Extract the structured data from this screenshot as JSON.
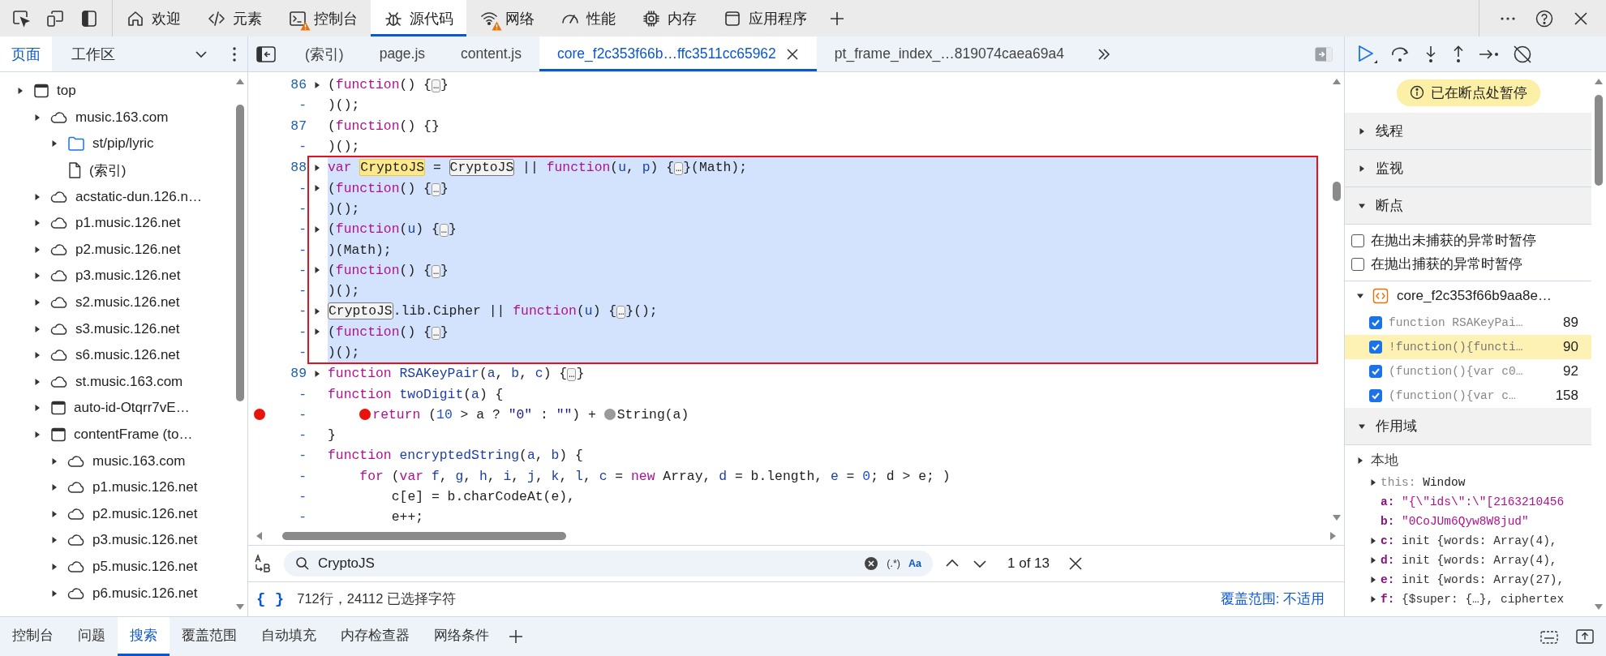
{
  "tabs": [
    {
      "label": "欢迎",
      "selected": false,
      "warning": false
    },
    {
      "label": "元素",
      "selected": false,
      "warning": false
    },
    {
      "label": "控制台",
      "selected": false,
      "warning": true
    },
    {
      "label": "源代码",
      "selected": true,
      "warning": false
    },
    {
      "label": "网络",
      "selected": false,
      "warning": true
    },
    {
      "label": "性能",
      "selected": false,
      "warning": false
    },
    {
      "label": "内存",
      "selected": false,
      "warning": false
    },
    {
      "label": "应用程序",
      "selected": false,
      "warning": false
    }
  ],
  "sidebar": {
    "tabs": [
      {
        "label": "页面",
        "selected": true
      },
      {
        "label": "工作区",
        "selected": false
      }
    ],
    "tree": [
      {
        "label": "top",
        "kind": "frame",
        "expandable": true,
        "children": [
          {
            "label": "music.163.com",
            "kind": "origin",
            "expandable": true,
            "children": [
              {
                "label": "st/pip/lyric",
                "kind": "folder",
                "expandable": true
              },
              {
                "label": "(索引)",
                "kind": "file",
                "expandable": false
              }
            ]
          },
          {
            "label": "acstatic-dun.126.n…",
            "kind": "origin",
            "expandable": true
          },
          {
            "label": "p1.music.126.net",
            "kind": "origin",
            "expandable": true
          },
          {
            "label": "p2.music.126.net",
            "kind": "origin",
            "expandable": true
          },
          {
            "label": "p3.music.126.net",
            "kind": "origin",
            "expandable": true
          },
          {
            "label": "s2.music.126.net",
            "kind": "origin",
            "expandable": true
          },
          {
            "label": "s3.music.126.net",
            "kind": "origin",
            "expandable": true
          },
          {
            "label": "s6.music.126.net",
            "kind": "origin",
            "expandable": true
          },
          {
            "label": "st.music.163.com",
            "kind": "origin",
            "expandable": true
          },
          {
            "label": "auto-id-Otqrr7vE…",
            "kind": "frame",
            "expandable": true
          },
          {
            "label": "contentFrame (to…",
            "kind": "frame",
            "expandable": true,
            "children": [
              {
                "label": "music.163.com",
                "kind": "origin",
                "expandable": true
              },
              {
                "label": "p1.music.126.net",
                "kind": "origin",
                "expandable": true
              },
              {
                "label": "p2.music.126.net",
                "kind": "origin",
                "expandable": true
              },
              {
                "label": "p3.music.126.net",
                "kind": "origin",
                "expandable": true
              },
              {
                "label": "p5.music.126.net",
                "kind": "origin",
                "expandable": true
              },
              {
                "label": "p6.music.126.net",
                "kind": "origin",
                "expandable": true
              }
            ]
          }
        ]
      }
    ]
  },
  "file_tabs": [
    {
      "label": "(索引)",
      "selected": false,
      "close_button": false
    },
    {
      "label": "page.js",
      "selected": false,
      "close_button": false
    },
    {
      "label": "content.js",
      "selected": false,
      "close_button": false
    },
    {
      "label": "core_f2c353f66b…ffc3511cc65962",
      "selected": true,
      "close_button": true
    },
    {
      "label": "pt_frame_index_…819074caea69a4",
      "selected": false,
      "close_button": false
    }
  ],
  "code": {
    "lines": [
      {
        "number": "86",
        "foldable": true,
        "selected": false,
        "breakpoint": false,
        "segments": [
          {
            "text": "("
          },
          {
            "text": "function",
            "kind": "keyword"
          },
          {
            "text": "() {"
          },
          {
            "text": "…",
            "kind": "fold"
          },
          {
            "text": "}"
          }
        ]
      },
      {
        "number": "-",
        "foldable": false,
        "selected": false,
        "breakpoint": false,
        "segments": [
          {
            "text": ")();"
          }
        ]
      },
      {
        "number": "87",
        "foldable": false,
        "selected": false,
        "breakpoint": false,
        "segments": [
          {
            "text": "("
          },
          {
            "text": "function",
            "kind": "keyword"
          },
          {
            "text": "() {}"
          }
        ]
      },
      {
        "number": "-",
        "foldable": false,
        "selected": false,
        "breakpoint": false,
        "segments": [
          {
            "text": ")();"
          }
        ]
      },
      {
        "number": "88",
        "foldable": true,
        "selected": true,
        "breakpoint": false,
        "segments": [
          {
            "text": "var ",
            "kind": "keyword"
          },
          {
            "text": "CryptoJS",
            "kind": "current_match"
          },
          {
            "text": " = "
          },
          {
            "text": "CryptoJS",
            "kind": "match"
          },
          {
            "text": " || "
          },
          {
            "text": "function",
            "kind": "keyword"
          },
          {
            "text": "("
          },
          {
            "text": "u",
            "kind": "ident"
          },
          {
            "text": ", "
          },
          {
            "text": "p",
            "kind": "ident"
          },
          {
            "text": ") {"
          },
          {
            "text": "…",
            "kind": "fold"
          },
          {
            "text": "}(Math);"
          }
        ]
      },
      {
        "number": "-",
        "foldable": true,
        "selected": true,
        "breakpoint": false,
        "segments": [
          {
            "text": "("
          },
          {
            "text": "function",
            "kind": "keyword"
          },
          {
            "text": "() {"
          },
          {
            "text": "…",
            "kind": "fold"
          },
          {
            "text": "}"
          }
        ]
      },
      {
        "number": "-",
        "foldable": false,
        "selected": true,
        "breakpoint": false,
        "segments": [
          {
            "text": ")();"
          }
        ]
      },
      {
        "number": "-",
        "foldable": true,
        "selected": true,
        "breakpoint": false,
        "segments": [
          {
            "text": "("
          },
          {
            "text": "function",
            "kind": "keyword"
          },
          {
            "text": "("
          },
          {
            "text": "u",
            "kind": "ident"
          },
          {
            "text": ") {"
          },
          {
            "text": "…",
            "kind": "fold"
          },
          {
            "text": "}"
          }
        ]
      },
      {
        "number": "-",
        "foldable": false,
        "selected": true,
        "breakpoint": false,
        "segments": [
          {
            "text": ")(Math);"
          }
        ]
      },
      {
        "number": "-",
        "foldable": true,
        "selected": true,
        "breakpoint": false,
        "segments": [
          {
            "text": "("
          },
          {
            "text": "function",
            "kind": "keyword"
          },
          {
            "text": "() {"
          },
          {
            "text": "…",
            "kind": "fold"
          },
          {
            "text": "}"
          }
        ]
      },
      {
        "number": "-",
        "foldable": false,
        "selected": true,
        "breakpoint": false,
        "segments": [
          {
            "text": ")();"
          }
        ]
      },
      {
        "number": "-",
        "foldable": true,
        "selected": true,
        "breakpoint": false,
        "segments": [
          {
            "text": "CryptoJS",
            "kind": "match"
          },
          {
            "text": ".lib.Cipher || "
          },
          {
            "text": "function",
            "kind": "keyword"
          },
          {
            "text": "("
          },
          {
            "text": "u",
            "kind": "ident"
          },
          {
            "text": ") {"
          },
          {
            "text": "…",
            "kind": "fold"
          },
          {
            "text": "}();"
          }
        ]
      },
      {
        "number": "-",
        "foldable": true,
        "selected": true,
        "breakpoint": false,
        "segments": [
          {
            "text": "("
          },
          {
            "text": "function",
            "kind": "keyword"
          },
          {
            "text": "() {"
          },
          {
            "text": "…",
            "kind": "fold"
          },
          {
            "text": "}"
          }
        ]
      },
      {
        "number": "-",
        "foldable": false,
        "selected": true,
        "breakpoint": false,
        "segments": [
          {
            "text": ")();"
          }
        ]
      },
      {
        "number": "89",
        "foldable": true,
        "selected": false,
        "breakpoint": false,
        "segments": [
          {
            "text": "function ",
            "kind": "keyword"
          },
          {
            "text": "RSAKeyPair",
            "kind": "ident"
          },
          {
            "text": "("
          },
          {
            "text": "a",
            "kind": "ident"
          },
          {
            "text": ", "
          },
          {
            "text": "b",
            "kind": "ident"
          },
          {
            "text": ", "
          },
          {
            "text": "c",
            "kind": "ident"
          },
          {
            "text": ") {"
          },
          {
            "text": "…",
            "kind": "fold"
          },
          {
            "text": "}"
          }
        ]
      },
      {
        "number": "-",
        "foldable": false,
        "selected": false,
        "breakpoint": false,
        "segments": [
          {
            "text": "function ",
            "kind": "keyword"
          },
          {
            "text": "twoDigit",
            "kind": "ident"
          },
          {
            "text": "("
          },
          {
            "text": "a",
            "kind": "ident"
          },
          {
            "text": ") {"
          }
        ]
      },
      {
        "number": "-",
        "foldable": false,
        "selected": false,
        "breakpoint": true,
        "segments": [
          {
            "text": "    return",
            "kind": "keyword",
            "inline_breakpoint": true,
            "breakpoint_enabled": true
          },
          {
            "text": " ("
          },
          {
            "text": "10",
            "kind": "number"
          },
          {
            "text": " > a ? "
          },
          {
            "text": "\"0\"",
            "kind": "string"
          },
          {
            "text": " : "
          },
          {
            "text": "\"\"",
            "kind": "string"
          },
          {
            "text": ") + "
          },
          {
            "text": "String(a)",
            "inline_breakpoint": true,
            "breakpoint_enabled": false
          }
        ]
      },
      {
        "number": "-",
        "foldable": false,
        "selected": false,
        "breakpoint": false,
        "segments": [
          {
            "text": "}"
          }
        ]
      },
      {
        "number": "-",
        "foldable": false,
        "selected": false,
        "breakpoint": false,
        "segments": [
          {
            "text": "function ",
            "kind": "keyword"
          },
          {
            "text": "encryptedString",
            "kind": "ident"
          },
          {
            "text": "("
          },
          {
            "text": "a",
            "kind": "ident"
          },
          {
            "text": ", "
          },
          {
            "text": "b",
            "kind": "ident"
          },
          {
            "text": ") {"
          }
        ]
      },
      {
        "number": "-",
        "foldable": false,
        "selected": false,
        "breakpoint": false,
        "segments": [
          {
            "text": "    for",
            "kind": "keyword"
          },
          {
            "text": " ("
          },
          {
            "text": "var ",
            "kind": "keyword"
          },
          {
            "text": "f",
            "kind": "ident"
          },
          {
            "text": ", "
          },
          {
            "text": "g",
            "kind": "ident"
          },
          {
            "text": ", "
          },
          {
            "text": "h",
            "kind": "ident"
          },
          {
            "text": ", "
          },
          {
            "text": "i",
            "kind": "ident"
          },
          {
            "text": ", "
          },
          {
            "text": "j",
            "kind": "ident"
          },
          {
            "text": ", "
          },
          {
            "text": "k",
            "kind": "ident"
          },
          {
            "text": ", "
          },
          {
            "text": "l",
            "kind": "ident"
          },
          {
            "text": ", "
          },
          {
            "text": "c",
            "kind": "ident"
          },
          {
            "text": " = "
          },
          {
            "text": "new",
            "kind": "keyword"
          },
          {
            "text": " Array, "
          },
          {
            "text": "d",
            "kind": "ident"
          },
          {
            "text": " = b.length, "
          },
          {
            "text": "e",
            "kind": "ident"
          },
          {
            "text": " = "
          },
          {
            "text": "0",
            "kind": "number"
          },
          {
            "text": "; d > e; )"
          }
        ]
      },
      {
        "number": "-",
        "foldable": false,
        "selected": false,
        "breakpoint": false,
        "segments": [
          {
            "text": "        c[e] = b.charCodeAt(e),"
          }
        ]
      },
      {
        "number": "-",
        "foldable": false,
        "selected": false,
        "breakpoint": false,
        "segments": [
          {
            "text": "        e++;"
          }
        ]
      }
    ]
  },
  "search": {
    "value": "CryptoJS",
    "regex_label": "(.*)",
    "case_label": "Aa",
    "result": "1 of 13"
  },
  "status_bar": {
    "format_label": "{ }",
    "selection": "712行，24112 已选择字符",
    "coverage": "覆盖范围: 不适用"
  },
  "debugger": {
    "status": "已在断点处暂停",
    "sections": [
      {
        "title": "线程",
        "expanded": false
      },
      {
        "title": "监视",
        "expanded": false
      },
      {
        "title": "断点",
        "expanded": true,
        "exception_options": [
          {
            "label": "在抛出未捕获的异常时暂停",
            "checked": false
          },
          {
            "label": "在抛出捕获的异常时暂停",
            "checked": false
          }
        ],
        "files": [
          {
            "name": "core_f2c353f66b9aa8e…",
            "expanded": true,
            "breakpoints": [
              {
                "code": "function RSAKeyPai…",
                "line": "89",
                "checked": true,
                "selected": false
              },
              {
                "code": "!function(){functi…",
                "line": "90",
                "checked": true,
                "selected": true
              },
              {
                "code": "(function(){var c0…",
                "line": "92",
                "checked": true,
                "selected": false
              },
              {
                "code": "(function(){var c…",
                "line": "158",
                "checked": true,
                "selected": false
              }
            ]
          }
        ]
      },
      {
        "title": "作用域",
        "expanded": true,
        "groups": [
          {
            "name": "本地",
            "expandable": true,
            "variables": [
              {
                "name": "this:",
                "value": "Window",
                "kind": "special",
                "expandable": true
              },
              {
                "name": "a:",
                "value": "\"{\\\"ids\\\":\\\"[2163210456",
                "kind": "string",
                "expandable": false
              },
              {
                "name": "b:",
                "value": "\"0CoJUm6Qyw8W8jud\"",
                "kind": "string",
                "expandable": false
              },
              {
                "name": "c:",
                "value": "init {words: Array(4),",
                "kind": "object",
                "expandable": true
              },
              {
                "name": "d:",
                "value": "init {words: Array(4),",
                "kind": "object",
                "expandable": true
              },
              {
                "name": "e:",
                "value": "init {words: Array(27),",
                "kind": "object",
                "expandable": true
              },
              {
                "name": "f:",
                "value": "{$super: {…}, ciphertex",
                "kind": "object",
                "expandable": true
              }
            ]
          }
        ]
      }
    ]
  },
  "drawer_tabs": [
    {
      "label": "控制台",
      "selected": false
    },
    {
      "label": "问题",
      "selected": false
    },
    {
      "label": "搜索",
      "selected": true
    },
    {
      "label": "覆盖范围",
      "selected": false
    },
    {
      "label": "自动填充",
      "selected": false
    },
    {
      "label": "内存检查器",
      "selected": false
    },
    {
      "label": "网络条件",
      "selected": false
    }
  ]
}
